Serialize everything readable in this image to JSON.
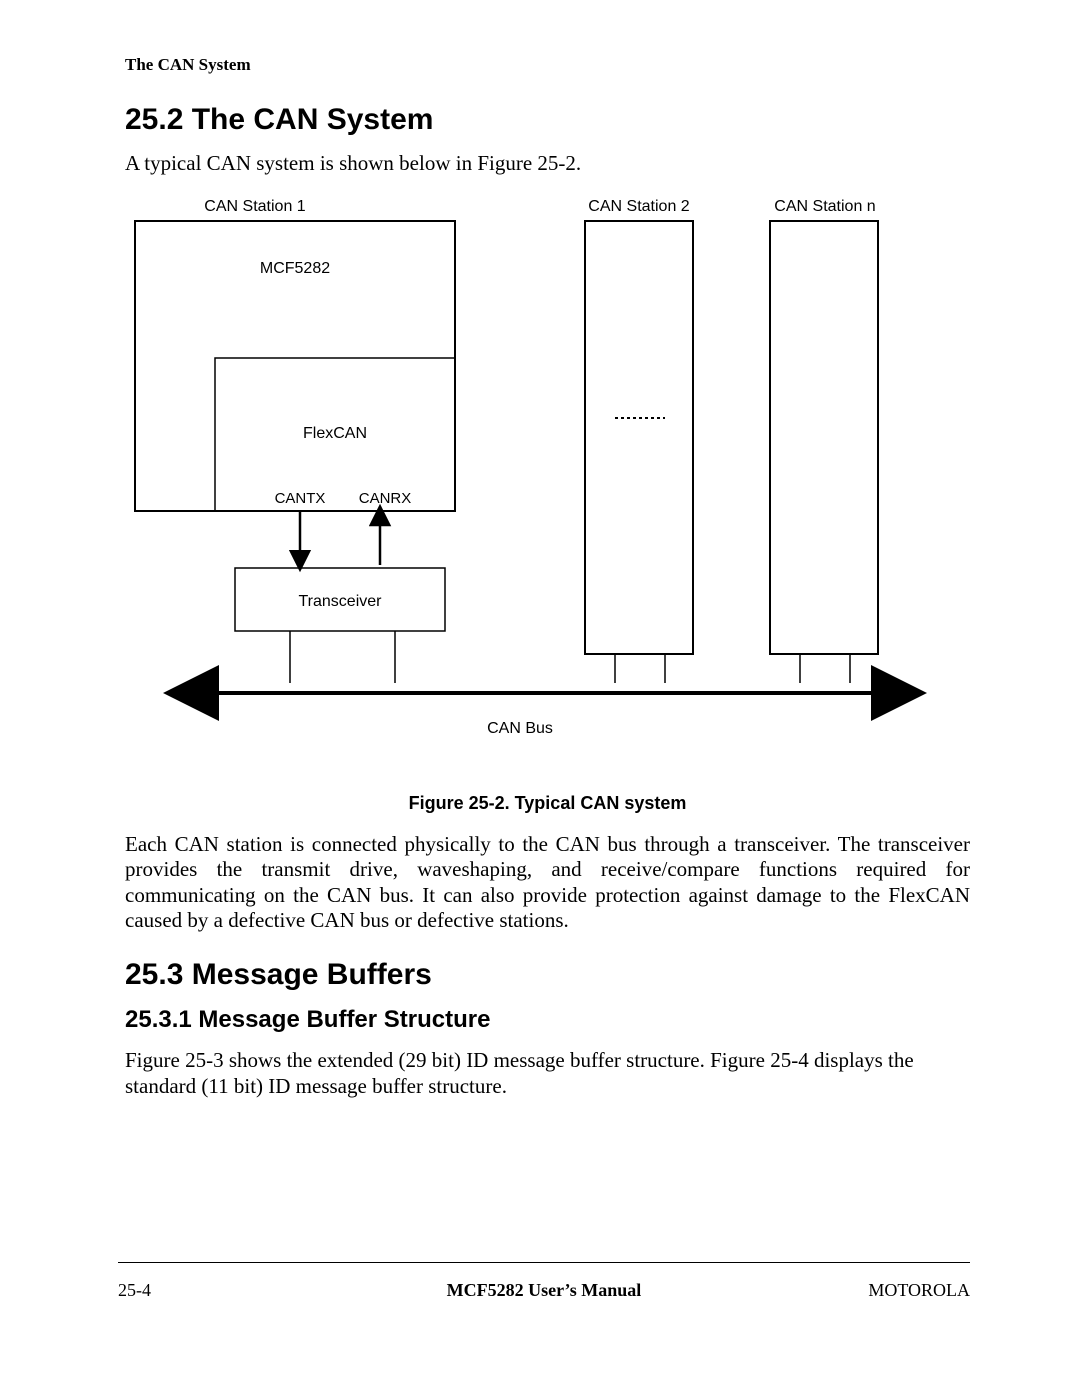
{
  "runningHeader": "The CAN System",
  "section252": {
    "heading": "25.2  The CAN System",
    "intro": "A typical CAN system is shown below in Figure 25-2."
  },
  "figure": {
    "labels": {
      "station1": "CAN Station 1",
      "station2": "CAN Station 2",
      "stationN": "CAN Station n",
      "chip": "MCF5282",
      "module": "FlexCAN",
      "tx": "CANTX",
      "rx": "CANRX",
      "transceiver": "Transceiver",
      "bus": "CAN Bus"
    },
    "caption": "Figure 25-2. Typical CAN system"
  },
  "para_after_figure": "Each CAN station is connected physically to the CAN bus through a transceiver. The transceiver provides the transmit drive, waveshaping, and receive/compare functions required for communicating on the CAN bus. It can also provide protection against damage to the FlexCAN caused by a defective CAN bus or defective stations.",
  "section253": {
    "heading": "25.3  Message Buffers",
    "sub1_heading": "25.3.1  Message Buffer Structure",
    "sub1_para": "Figure 25-3 shows the extended (29 bit) ID message buffer structure. Figure 25-4 displays the standard (11 bit) ID message buffer structure."
  },
  "footer": {
    "left": "25-4",
    "center": "MCF5282 User’s Manual",
    "right": "MOTOROLA"
  }
}
